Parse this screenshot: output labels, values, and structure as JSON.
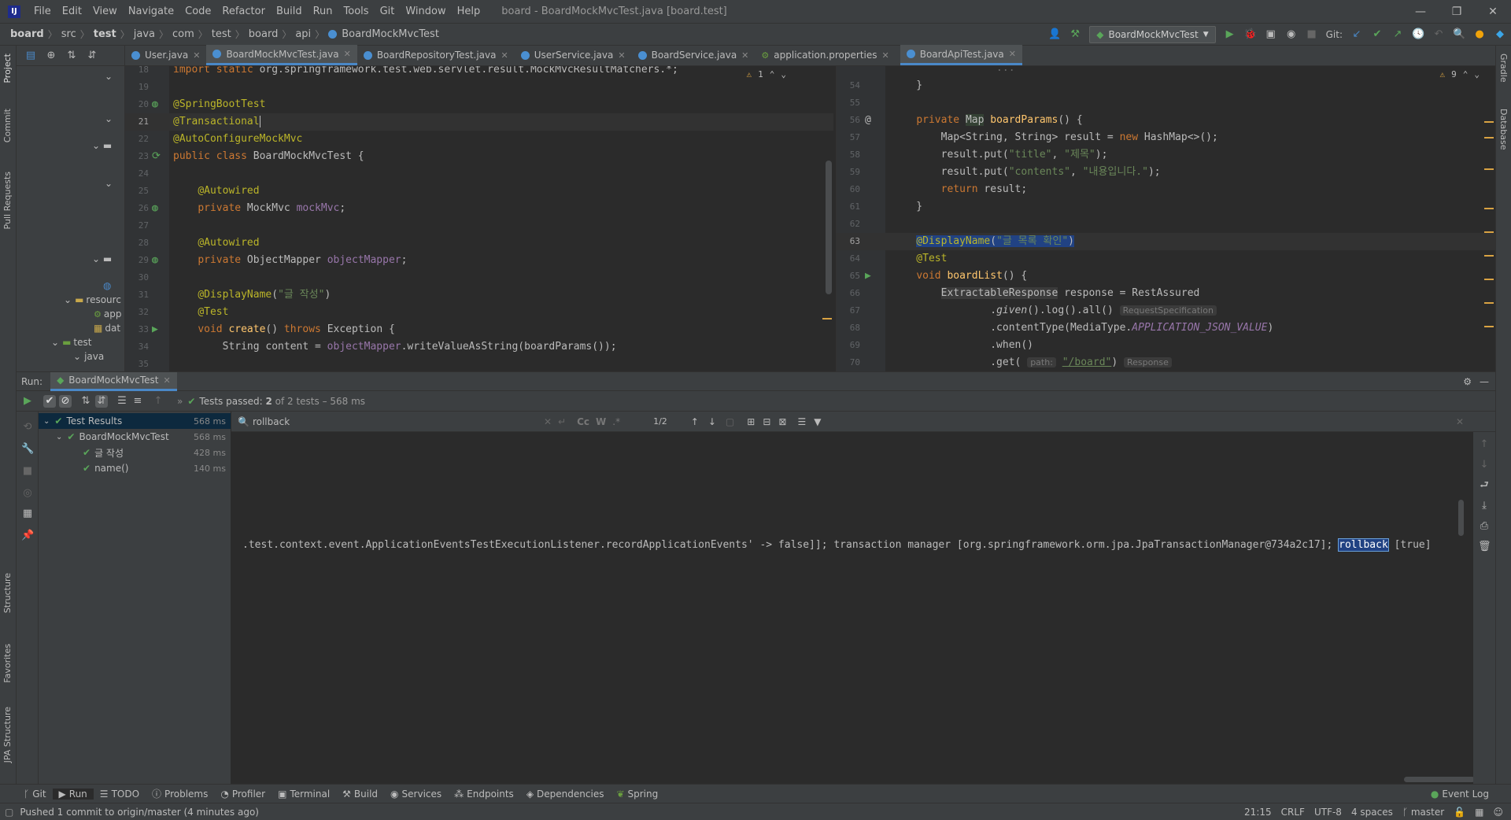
{
  "menubar": {
    "logo": "IJ",
    "items": [
      "File",
      "Edit",
      "View",
      "Navigate",
      "Code",
      "Refactor",
      "Build",
      "Run",
      "Tools",
      "Git",
      "Window",
      "Help"
    ],
    "window_title": "board - BoardMockMvcTest.java [board.test]"
  },
  "navbar": {
    "breadcrumbs": [
      "board",
      "src",
      "test",
      "java",
      "com",
      "test",
      "board",
      "api",
      "BoardMockMvcTest"
    ],
    "run_config": "BoardMockMvcTest",
    "git_label": "Git:"
  },
  "sidebar_left": {
    "project": "Project",
    "commit": "Commit",
    "pull_requests": "Pull Requests",
    "structure": "Structure",
    "favorites": "Favorites",
    "jpa_structure": "JPA Structure"
  },
  "sidebar_right": {
    "gradle": "Gradle",
    "database": "Database"
  },
  "project_tree": {
    "items": [
      "resourc",
      "app",
      "dat",
      "test",
      "java"
    ]
  },
  "tabs": [
    {
      "label": "User.java",
      "active": false
    },
    {
      "label": "BoardMockMvcTest.java",
      "active": true
    },
    {
      "label": "BoardRepositoryTest.java",
      "active": false
    },
    {
      "label": "UserService.java",
      "active": false
    },
    {
      "label": "BoardService.java",
      "active": false
    },
    {
      "label": "application.properties",
      "active": false
    },
    {
      "label": "BoardApiTest.java",
      "active": true
    }
  ],
  "editor_left": {
    "warnings": "1",
    "line_numbers": [
      "18",
      "19",
      "20",
      "21",
      "22",
      "23",
      "24",
      "25",
      "26",
      "27",
      "28",
      "29",
      "30",
      "31",
      "32",
      "33",
      "34",
      "35"
    ]
  },
  "editor_right": {
    "warnings": "9",
    "line_numbers": [
      "54",
      "55",
      "56",
      "57",
      "58",
      "59",
      "60",
      "61",
      "62",
      "63",
      "64",
      "65",
      "66",
      "67",
      "68",
      "69",
      "70"
    ]
  },
  "run_panel": {
    "run_label": "Run:",
    "tab": "BoardMockMvcTest",
    "status_prefix": "Tests passed:",
    "passed": "2",
    "status_suffix": "of 2 tests – 568 ms",
    "tree": [
      {
        "label": "Test Results",
        "time": "568 ms"
      },
      {
        "label": "BoardMockMvcTest",
        "time": "568 ms"
      },
      {
        "label": "글 작성",
        "time": "428 ms"
      },
      {
        "label": "name()",
        "time": "140 ms"
      }
    ],
    "search": {
      "value": "rollback",
      "match_count": "1/2"
    },
    "console_line_before": ".test.context.event.ApplicationEventsTestExecutionListener.recordApplicationEvents' -> false]]; transaction manager [org.springframework.orm.jpa.JpaTransactionManager@734a2c17]; ",
    "console_highlight": "rollback",
    "console_line_after": " [true]"
  },
  "bottom_tools": [
    "Git",
    "Run",
    "TODO",
    "Problems",
    "Profiler",
    "Terminal",
    "Build",
    "Services",
    "Endpoints",
    "Dependencies",
    "Spring"
  ],
  "event_log": "Event Log",
  "statusbar": {
    "message": "Pushed 1 commit to origin/master (4 minutes ago)",
    "position": "21:15",
    "line_sep": "CRLF",
    "encoding": "UTF-8",
    "indent": "4 spaces",
    "branch": "master"
  },
  "colors": {
    "accent": "#4a88c7",
    "pass": "#5aa65a",
    "keyword": "#cc7832",
    "annotation": "#bbb529",
    "string": "#6a8759"
  }
}
